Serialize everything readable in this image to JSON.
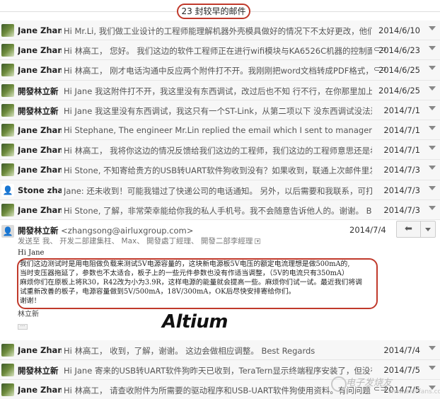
{
  "header": {
    "count_label": "23 封较早的邮件"
  },
  "threads": [
    {
      "sender": "Jane Zhang",
      "subject": "Hi Mr.Li, 我们做工业设计的工程师能理解机器外壳模具做好的情况下不太好更改，他们同意在",
      "date": "2014/6/10",
      "attach": false
    },
    {
      "sender": "Jane Zhang",
      "subject": "Hi 林高工， 您好。 我们这边的软件工程师正在进行wifi模块与KA6526C机器的控制面板",
      "date": "2014/6/23",
      "attach": true
    },
    {
      "sender": "Jane Zhang",
      "subject": "Hi 林高工， 刚才电话沟通中反应两个附件打不开。我刚刚把word文档转成PDF格式，把",
      "date": "2014/6/25",
      "attach": true
    },
    {
      "sender": "開發林立新",
      "subject": "Hi Jane 我这附件打不开，我这里没有东西调试，改过后也不知 行不行，在你那里加上去应该",
      "date": "2014/6/25",
      "attach": false
    },
    {
      "sender": "開發林立新",
      "subject": "Hi Jane 我这里没有东西调试，我这只有一个ST-Link，从第二项以下 没东西调试没法进行了，",
      "date": "2014/7/1",
      "attach": false
    },
    {
      "sender": "Jane Zhang",
      "subject": "Hi Stephane, The engineer Mr.Lin replied the email which I sent to manager Zh...",
      "date": "2014/7/1",
      "attach": false
    },
    {
      "sender": "Jane Zhang",
      "subject": "Hi 林高工， 我将你这边的情况反馈给我们这边的工程师，我们这边的工程师意思还是希望在机",
      "date": "2014/7/1",
      "attach": false
    },
    {
      "sender": "Jane Zhang",
      "subject": "Hi Stone, 不知寄给贵方的USB转UART软件狗收到没有？如果收到，联通上次邮件里发来的Ter",
      "date": "2014/7/3",
      "attach": false
    },
    {
      "sender": "Stone zhang",
      "subject": "Jane: 还未收到！可能我错过了快递公司的电话通知。 另外，以后需要和我联系，可打我另一",
      "date": "2014/7/3",
      "attach": false,
      "person": true
    },
    {
      "sender": "Jane Zhang",
      "subject": "Hi Stone, 了解，非常荣幸能给你我的私人手机号。我不会随意告诉他人的。谢谢。 Best Regar",
      "date": "2014/7/3",
      "attach": false
    }
  ],
  "open_message": {
    "from_name": "開發林立新",
    "from_email": "<zhangsong@airluxgroup.com>",
    "to_line": "发送至 我、 开发二部建集柱、 Max、 開發處丁經理、 開發二部李經理",
    "date": "2014/7/4",
    "greeting": "Hi Jane",
    "body_lines": [
      "我们这边测试时是用电阻做负载来测试5V电源容量的，这块新电源板5V电压的额定电流理想是做500mA的,",
      "当时变压器拖延了，参数也不太适合，板子上的一些元件参数也没有作适当调整，（5V的电流只有350mA）",
      "麻烦你们在原板上将R30，R42改为小为3.9R，这样电源的能量就会提高一些。麻烦你们试一试。最近我们将调",
      "试重新改善的板子，电源容量做到5V/500mA，18V/300mA，OK后尽快安排寄给你们。",
      "谢谢！"
    ],
    "signature": "林立新"
  },
  "logo_text": "Altium",
  "threads2": [
    {
      "sender": "Jane Zhang",
      "subject": "Hi 林高工， 收到，了解，谢谢。 这边会做相应调整。 Best Regards",
      "date": "2014/7/4",
      "attach": false
    },
    {
      "sender": "開發林立新",
      "subject": "Hi Jane 寄来的USB转UART软件狗昨天已收到，TeraTern显示终端程序安装了，但没有驱动",
      "date": "2014/7/5",
      "attach": false
    },
    {
      "sender": "Jane Zhang",
      "subject": "Hi 林高工， 请查收附件为所需要的驱动程序和USB-UART软件狗使用资料。有问问题",
      "date": "2014/7/5",
      "attach": true
    }
  ],
  "watermark": {
    "text": "电子发烧友",
    "url": "www.elecfans.com"
  },
  "colors": {
    "highlight_border": "#c0392b",
    "row_bg": "#f7f7f7"
  }
}
